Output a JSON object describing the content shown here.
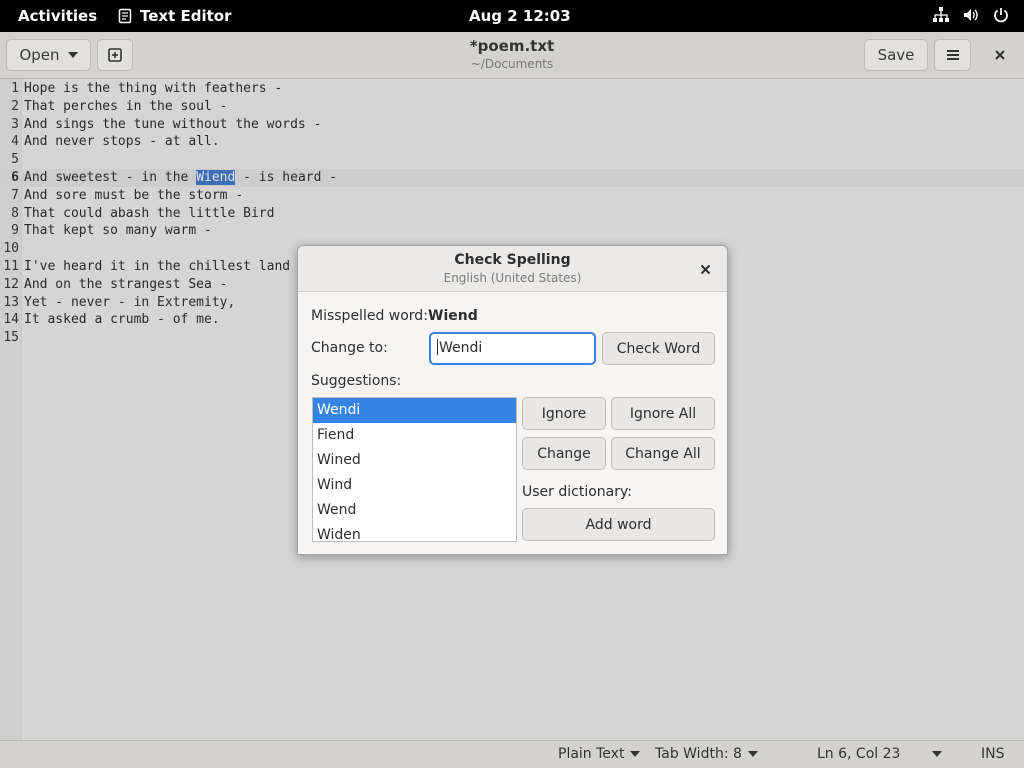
{
  "topbar": {
    "activities": "Activities",
    "app_name": "Text Editor",
    "clock": "Aug 2  12:03"
  },
  "window": {
    "title": "*poem.txt",
    "subtitle": "~/Documents",
    "open_label": "Open",
    "save_label": "Save"
  },
  "editor": {
    "current_line": 6,
    "highlighted_word": "Wiend",
    "lines": [
      {
        "n": "1",
        "text": "Hope is the thing with feathers -"
      },
      {
        "n": "2",
        "text": "That perches in the soul -"
      },
      {
        "n": "3",
        "text": "And sings the tune without the words -"
      },
      {
        "n": "4",
        "text": "And never stops - at all."
      },
      {
        "n": "5",
        "text": ""
      },
      {
        "n": "6",
        "text": "And sweetest - in the Wiend - is heard -"
      },
      {
        "n": "7",
        "text": "And sore must be the storm -"
      },
      {
        "n": "8",
        "text": "That could abash the little Bird"
      },
      {
        "n": "9",
        "text": "That kept so many warm -"
      },
      {
        "n": "10",
        "text": ""
      },
      {
        "n": "11",
        "text": "I've heard it in the chillest land -"
      },
      {
        "n": "12",
        "text": "And on the strangest Sea -"
      },
      {
        "n": "13",
        "text": "Yet - never - in Extremity,"
      },
      {
        "n": "14",
        "text": "It asked a crumb - of me."
      },
      {
        "n": "15",
        "text": ""
      }
    ]
  },
  "statusbar": {
    "language": "Plain Text",
    "tab_width": "Tab Width: 8",
    "position": "Ln 6, Col 23",
    "mode": "INS"
  },
  "dialog": {
    "title": "Check Spelling",
    "subtitle": "English (United States)",
    "misspelled_label": "Misspelled word:",
    "misspelled_word": "Wiend",
    "change_to_label": "Change to:",
    "change_to_value": "Wendi",
    "check_word": "Check Word",
    "suggestions_label": "Suggestions:",
    "suggestions": [
      "Wendi",
      "Fiend",
      "Wined",
      "Wind",
      "Wend",
      "Widen"
    ],
    "selected_suggestion": 0,
    "ignore": "Ignore",
    "ignore_all": "Ignore All",
    "change": "Change",
    "change_all": "Change All",
    "user_dictionary_label": "User dictionary:",
    "add_word": "Add word"
  }
}
